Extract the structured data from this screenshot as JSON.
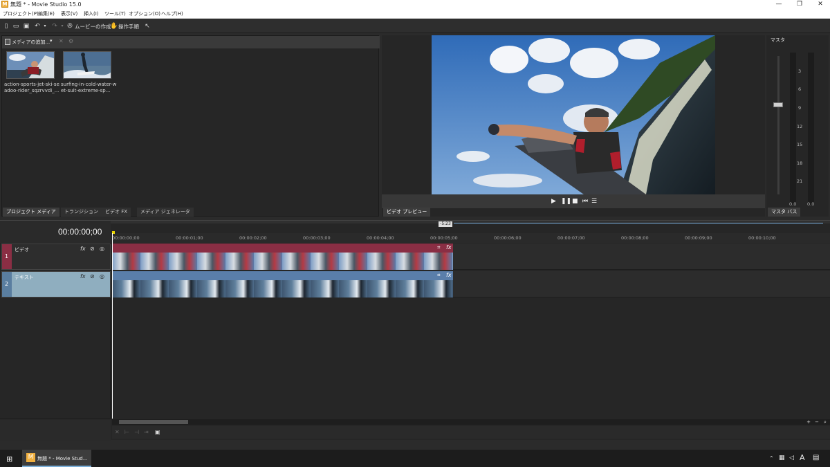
{
  "window": {
    "app_icon": "M",
    "title": "無題 * - Movie Studio 15.0",
    "minimize": "—",
    "maximize": "❐",
    "close": "✕"
  },
  "menu": [
    "プロジェクト(P)",
    "編集(E)",
    "表示(V)",
    "挿入(I)",
    "ツール(T)",
    "オプション(O)",
    "ヘルプ(H)"
  ],
  "toolbar": {
    "make_movie": "ムービーの作成",
    "guide": "操作手順"
  },
  "media": {
    "add_media": "メディアの追加...",
    "items": [
      {
        "caption": "action-sports-jet-ski-seadoo-rider_sqzrvvdi_..."
      },
      {
        "caption": "surfing-in-cold-water-wet-suit-extreme-sp..."
      }
    ],
    "tabs": [
      "プロジェクト メディア",
      "トランジション",
      "ビデオ FX",
      "メディア ジェネレータ"
    ]
  },
  "preview": {
    "tab": "ビデオ プレビュー"
  },
  "master": {
    "label": "マスタ",
    "ticks": [
      "3",
      "6",
      "9",
      "12",
      "15",
      "18",
      "21"
    ],
    "left_value": "0.0",
    "right_value": "0.0",
    "tab": "マスタ バス"
  },
  "timeline": {
    "timecode": "00:00:00;00",
    "region_marker": "-5:23",
    "ruler": [
      "00:00:00;00",
      "00:00:01;00",
      "00:00:02;00",
      "00:00:03;00",
      "00:00:04;00",
      "00:00:05;00",
      "00:00:06;00",
      "00:00:07;00",
      "00:00:08;00",
      "00:00:09;00",
      "00:00:10;00"
    ],
    "tracks": [
      {
        "number": "1",
        "name": "ビデオ",
        "color": "#8a2e44"
      },
      {
        "number": "2",
        "name": "テキスト",
        "color": "#6b8ca8"
      }
    ]
  },
  "taskbar": {
    "app_label": "無題 * - Movie Stud...",
    "ime": "A"
  }
}
